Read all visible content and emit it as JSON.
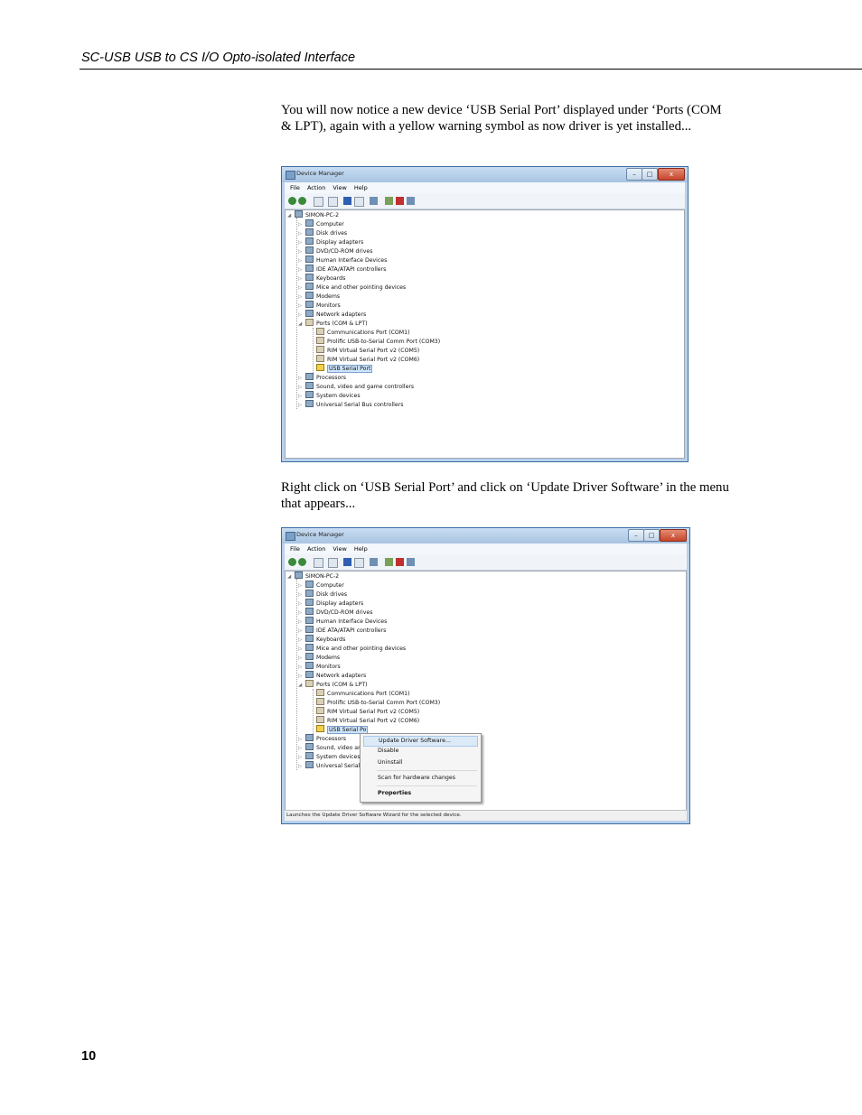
{
  "header": {
    "title": "SC-USB USB to CS I/O Opto-isolated Interface"
  },
  "paragraphs": {
    "p1": "You will now notice a new device ‘USB Serial Port’ displayed under ‘Ports (COM & LPT), again with a yellow warning symbol as now driver is yet installed...",
    "p2": "Right click on ‘USB Serial Port’ and click on ‘Update Driver Software’ in the menu that appears..."
  },
  "page_number": "10",
  "device_manager": {
    "title": "Device Manager",
    "window_controls": {
      "minimize": "–",
      "maximize": "□",
      "close": "x"
    },
    "menu": [
      "File",
      "Action",
      "View",
      "Help"
    ],
    "root": "SIMON-PC-2",
    "categories": [
      "Computer",
      "Disk drives",
      "Display adapters",
      "DVD/CD-ROM drives",
      "Human Interface Devices",
      "IDE ATA/ATAPI controllers",
      "Keyboards",
      "Mice and other pointing devices",
      "Modems",
      "Monitors",
      "Network adapters",
      "Ports (COM & LPT)"
    ],
    "ports": [
      "Communications Port (COM1)",
      "Prolific USB-to-Serial Comm Port (COM3)",
      "RIM Virtual Serial Port v2 (COM5)",
      "RIM Virtual Serial Port v2 (COM6)",
      "USB Serial Port"
    ],
    "after_ports": [
      "Processors",
      "Sound, video and game controllers",
      "System devices",
      "Universal Serial Bus controllers"
    ],
    "after_ports_truncated": [
      "Processors",
      "Sound, video ar",
      "System devices",
      "Universal Serial"
    ],
    "selected_truncated": "USB Serial Po",
    "status_text": "Launches the Update Driver Software Wizard for the selected device."
  },
  "context_menu": {
    "update": "Update Driver Software...",
    "disable": "Disable",
    "uninstall": "Uninstall",
    "scan": "Scan for hardware changes",
    "properties": "Properties"
  },
  "icons": {
    "tree_expanded": "expanded-triangle-icon",
    "tree_collapsed": "collapsed-triangle-icon",
    "port": "port-connector-icon",
    "warning": "warning-icon"
  }
}
